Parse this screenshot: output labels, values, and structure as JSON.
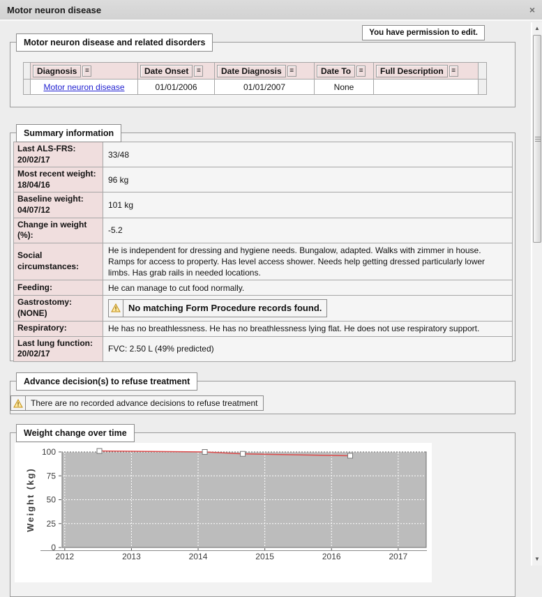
{
  "window": {
    "title": "Motor neuron disease",
    "close_icon": "×",
    "permission_badge": "You have permission to edit."
  },
  "icons": {
    "scroll_up": "▲",
    "scroll_down": "▼",
    "filter_menu": "≡"
  },
  "disorders_section": {
    "legend": "Motor neuron disease and related disorders",
    "table": {
      "columns": [
        "Diagnosis",
        "Date Onset",
        "Date Diagnosis",
        "Date To",
        "Full Description"
      ],
      "rows": [
        {
          "diagnosis": "Motor neuron disease",
          "date_onset": "01/01/2006",
          "date_diagnosis": "01/01/2007",
          "date_to": "None",
          "full_description": ""
        }
      ]
    }
  },
  "summary_section": {
    "legend": "Summary information",
    "rows": [
      {
        "label": "Last ALS-FRS:",
        "sub": "20/02/17",
        "value": "33/48"
      },
      {
        "label": "Most recent weight:",
        "sub": "18/04/16",
        "value": "96 kg"
      },
      {
        "label": "Baseline weight:",
        "sub": "04/07/12",
        "value": "101 kg"
      },
      {
        "label": "Change in weight (%):",
        "sub": "",
        "value": "-5.2"
      },
      {
        "label": "Social circumstances:",
        "sub": "",
        "value": "He is independent for dressing and hygiene needs. Bungalow, adapted. Walks with zimmer in house. Ramps for access to property. Has level access shower. Needs help getting dressed particularly lower limbs. Has grab rails in needed locations."
      },
      {
        "label": "Feeding:",
        "sub": "",
        "value": "He can manage to cut food normally."
      },
      {
        "label": "Gastrostomy:",
        "sub": "(NONE)",
        "warning": "No matching Form Procedure records found."
      },
      {
        "label": "Respiratory:",
        "sub": "",
        "value": "He has no breathlessness. He has no breathlessness lying flat. He does not use respiratory support."
      },
      {
        "label": "Last lung function:",
        "sub": "20/02/17",
        "value": "FVC: 2.50 L (49% predicted)"
      }
    ]
  },
  "advance_section": {
    "legend": "Advance decision(s) to refuse treatment",
    "warning": "There are no recorded advance decisions to refuse treatment"
  },
  "chart_section": {
    "legend": "Weight change over time"
  },
  "chart_data": {
    "type": "line",
    "title": "Weight change over time",
    "ylabel": "Weight (kg)",
    "x": [
      2012.52,
      2014.1,
      2014.67,
      2016.28
    ],
    "values": [
      101,
      100,
      98,
      96
    ],
    "xticks": [
      2012,
      2013,
      2014,
      2015,
      2016,
      2017
    ],
    "yticks": [
      0,
      25,
      50,
      75,
      100
    ],
    "xlim": [
      2011.96,
      2017.42
    ],
    "ylim": [
      0,
      100
    ],
    "line_color": "#dd4a4a",
    "marker": "square",
    "marker_fill": "#ffffff",
    "marker_stroke": "#777777",
    "plot_bg": "#bcbcbc",
    "grid_color": "#ffffff",
    "grid_style": "dashed",
    "legend_position": "none"
  }
}
